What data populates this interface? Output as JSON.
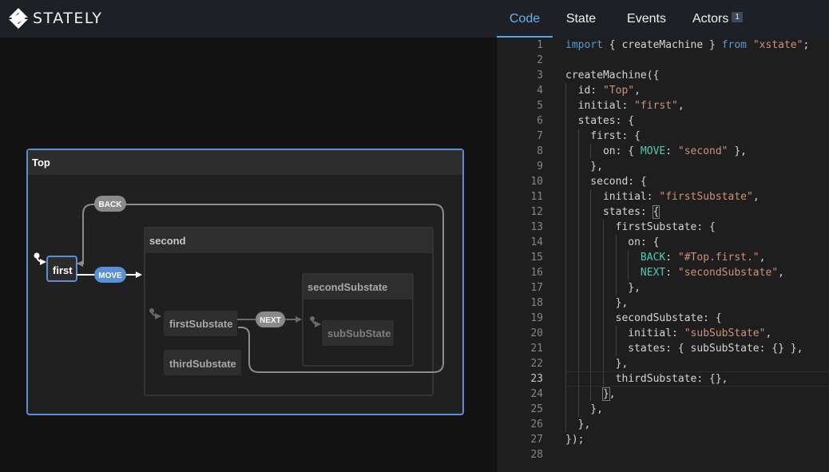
{
  "app": {
    "logo_text": "STATELY"
  },
  "tabs": [
    {
      "label": "Code",
      "active": true
    },
    {
      "label": "State"
    },
    {
      "label": "Events"
    },
    {
      "label": "Actors",
      "badge": "1"
    }
  ],
  "diagram": {
    "root": {
      "label": "Top"
    },
    "first": {
      "label": "first"
    },
    "second": {
      "label": "second"
    },
    "first_substate": {
      "label": "firstSubstate"
    },
    "second_substate": {
      "label": "secondSubstate"
    },
    "sub_sub_state": {
      "label": "subSubState"
    },
    "third_substate": {
      "label": "thirdSubstate"
    },
    "events": {
      "back": "BACK",
      "move": "MOVE",
      "next": "NEXT"
    }
  },
  "code": {
    "current_line": 23,
    "lines": [
      [
        [
          "kw",
          "import"
        ],
        [
          "p",
          " { createMachine } "
        ],
        [
          "kw",
          "from"
        ],
        [
          "p",
          " "
        ],
        [
          "str",
          "\"xstate\""
        ],
        [
          "p",
          ";"
        ]
      ],
      [],
      [
        [
          "p",
          "createMachine({"
        ]
      ],
      [
        [
          "p",
          "  id: "
        ],
        [
          "str",
          "\"Top\""
        ],
        [
          "p",
          ","
        ]
      ],
      [
        [
          "p",
          "  initial: "
        ],
        [
          "str",
          "\"first\""
        ],
        [
          "p",
          ","
        ]
      ],
      [
        [
          "p",
          "  states: {"
        ]
      ],
      [
        [
          "p",
          "    first: {"
        ]
      ],
      [
        [
          "p",
          "      on: { "
        ],
        [
          "key",
          "MOVE"
        ],
        [
          "p",
          ": "
        ],
        [
          "str",
          "\"second\""
        ],
        [
          "p",
          " },"
        ]
      ],
      [
        [
          "p",
          "    },"
        ]
      ],
      [
        [
          "p",
          "    second: {"
        ]
      ],
      [
        [
          "p",
          "      initial: "
        ],
        [
          "str",
          "\"firstSubstate\""
        ],
        [
          "p",
          ","
        ]
      ],
      [
        [
          "p",
          "      states: "
        ],
        [
          "br",
          "{"
        ]
      ],
      [
        [
          "p",
          "        firstSubstate: {"
        ]
      ],
      [
        [
          "p",
          "          on: {"
        ]
      ],
      [
        [
          "p",
          "            "
        ],
        [
          "key",
          "BACK"
        ],
        [
          "p",
          ": "
        ],
        [
          "str",
          "\"#Top.first.\""
        ],
        [
          "p",
          ","
        ]
      ],
      [
        [
          "p",
          "            "
        ],
        [
          "key",
          "NEXT"
        ],
        [
          "p",
          ": "
        ],
        [
          "str",
          "\"secondSubstate\""
        ],
        [
          "p",
          ","
        ]
      ],
      [
        [
          "p",
          "          },"
        ]
      ],
      [
        [
          "p",
          "        },"
        ]
      ],
      [
        [
          "p",
          "        secondSubstate: {"
        ]
      ],
      [
        [
          "p",
          "          initial: "
        ],
        [
          "str",
          "\"subSubState\""
        ],
        [
          "p",
          ","
        ]
      ],
      [
        [
          "p",
          "          states: { subSubState: {} },"
        ]
      ],
      [
        [
          "p",
          "        },"
        ]
      ],
      [
        [
          "p",
          "        thirdSubstate: {},"
        ]
      ],
      [
        [
          "p",
          "      "
        ],
        [
          "br",
          "}"
        ],
        [
          "p",
          ","
        ]
      ],
      [
        [
          "p",
          "    },"
        ]
      ],
      [
        [
          "p",
          "  },"
        ]
      ],
      [
        [
          "p",
          "});"
        ]
      ],
      []
    ]
  }
}
